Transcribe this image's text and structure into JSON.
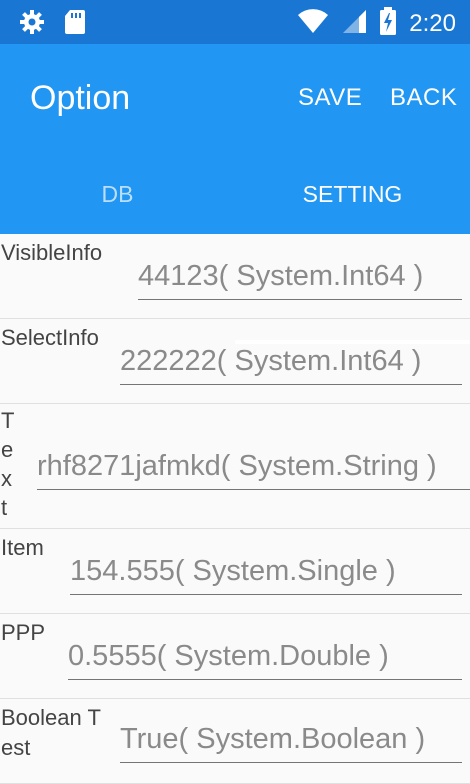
{
  "status_bar": {
    "icons_left": [
      "gear-icon",
      "sd-card-icon"
    ],
    "icons_right": [
      "wifi-icon",
      "signal-icon",
      "battery-charging-icon"
    ],
    "time": "2:20"
  },
  "app_bar": {
    "title": "Option",
    "save_label": "SAVE",
    "back_label": "BACK"
  },
  "tabs": [
    {
      "label": "DB",
      "selected": false
    },
    {
      "label": "SETTING",
      "selected": true
    }
  ],
  "colors": {
    "status_bar": "#1976d2",
    "app_bar": "#2196f3",
    "background": "#fafafa",
    "value_text": "#8a8a8a"
  },
  "fields": [
    {
      "label": "VisibleInfo",
      "value": "44123( System.Int64 )"
    },
    {
      "label": "SelectInfo",
      "value": "222222( System.Int64 )"
    },
    {
      "label": "Text",
      "value": "rhf8271jafmkd( System.String )"
    },
    {
      "label": "Item",
      "value": "154.555( System.Single )"
    },
    {
      "label": "PPP",
      "value": "0.5555( System.Double )"
    },
    {
      "label": "Boolean Test",
      "value": "True( System.Boolean )"
    }
  ]
}
